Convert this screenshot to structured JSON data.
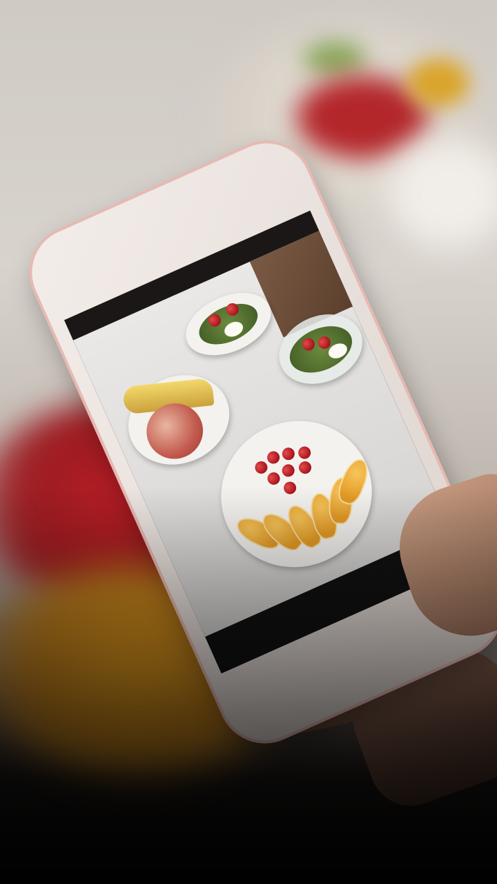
{
  "scene": {
    "description_visible_text": "",
    "colors": {
      "phone_body": "#f3ede9",
      "phone_edge": "#e7b9b3",
      "tomato": "#b81d24",
      "orange": "#e39a23",
      "table": "#eae8e6",
      "bottom_fade": "#0b0a0a"
    }
  }
}
